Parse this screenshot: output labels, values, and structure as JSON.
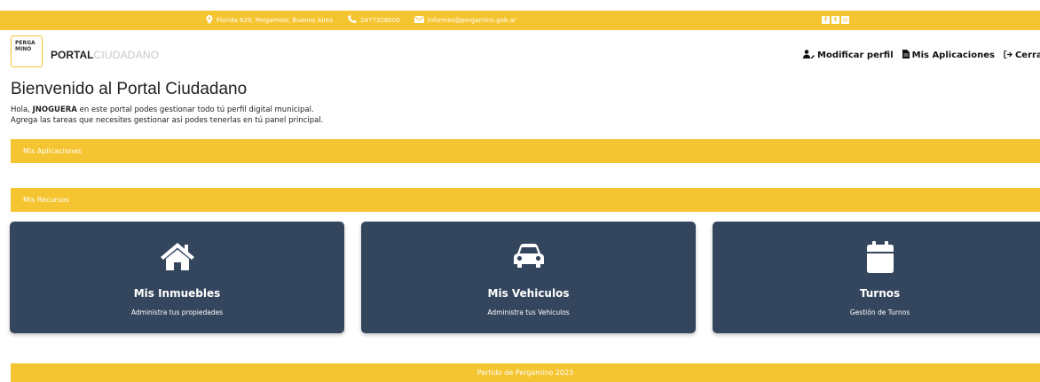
{
  "topbar": {
    "address": "Florida 629, Pergamino, Buenos Aires",
    "phone": "2477328000",
    "email": "informes@pergamino.gob.ar",
    "social_icons": [
      "facebook-icon",
      "twitter-icon",
      "instagram-icon"
    ]
  },
  "logo": {
    "line1": "PERGA",
    "line2": "MINO"
  },
  "brand": {
    "bold": "PORTAL",
    "light": "CIUDADANO"
  },
  "user_nav": {
    "profile": "Modificar perfil",
    "apps": "Mis Aplicaciones",
    "logout": "Cerrar sesión"
  },
  "welcome": {
    "title": "Bienvenido al Portal Ciudadano",
    "hello": "Hola,",
    "username": "JNOGUERA",
    "line1_rest": "en este portal podes gestionar todo tú perfil digital municipal.",
    "line2": "Agrega las tareas que necesites gestionar asi podes tenerlas en tú panel principal."
  },
  "sections": {
    "apps": "Mis Aplicaciones",
    "resources": "Mis Recursos"
  },
  "cards": [
    {
      "title": "Mis Inmuebles",
      "subtitle": "Administra tus propiedades",
      "icon": "house-icon"
    },
    {
      "title": "Mis Vehiculos",
      "subtitle": "Administra tus Vehiculos",
      "icon": "car-icon"
    },
    {
      "title": "Turnos",
      "subtitle": "Gestión de Turnos",
      "icon": "calendar-icon"
    }
  ],
  "footer": "Partido de Pergamino 2023",
  "colors": {
    "accent": "#f5c431",
    "card": "#34465d"
  }
}
